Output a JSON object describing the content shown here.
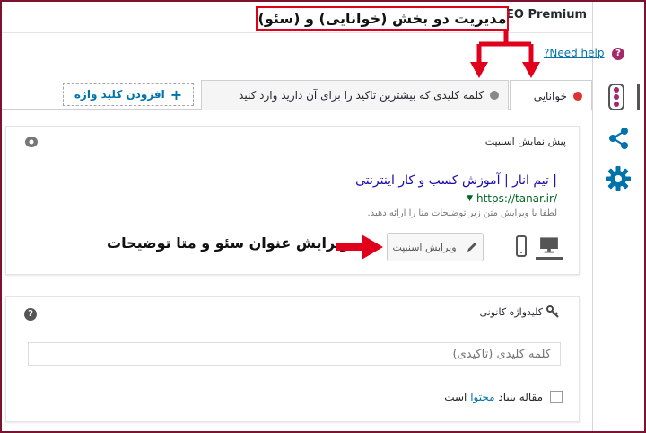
{
  "header": {
    "plugin_title": "Yoast SEO Premium",
    "annotation_top": "مدیریت دو بخش (خوانایی) و (سئو)"
  },
  "help": {
    "link_text": "?Need help"
  },
  "tabs": [
    {
      "label": "خوانایی",
      "status": "red",
      "active": true
    },
    {
      "label": "کلمه کلیدی که بیشترین تاکید را برای آن دارید وارد کنید",
      "status": "gray",
      "active": false
    }
  ],
  "add_keyword": {
    "label": "افزودن کلید واژه"
  },
  "snippet": {
    "panel_title": "پیش نمایش اسنیپت",
    "title": "| تیم انار | آموزش کسب و کار اینترنتی",
    "url": "https://tanar.ir/",
    "description": "لطفا با ویرایش متن زیر توضیحات متا را ارائه دهید.",
    "edit_button": "ویرایش اسنیپت",
    "annotation": "ویرایش عنوان سئو و متا توضیحات"
  },
  "keyphrase": {
    "panel_title": "کلیدواژه کانونی",
    "input_placeholder": "کلمه کلیدی (تاکیدی)",
    "cornerstone_prefix": "مقاله بنیاد",
    "cornerstone_link": "محتوا",
    "cornerstone_suffix": "است"
  },
  "colors": {
    "accent": "#a4286a",
    "link": "#0073aa",
    "annotation": "#e0001b",
    "status_bad": "#dc3232"
  },
  "icons": [
    "help-icon",
    "traffic-light-icon",
    "share-icon",
    "gear-icon",
    "eye-icon",
    "question-icon",
    "key-icon",
    "pencil-icon",
    "mobile-icon",
    "desktop-icon",
    "plus-icon"
  ]
}
